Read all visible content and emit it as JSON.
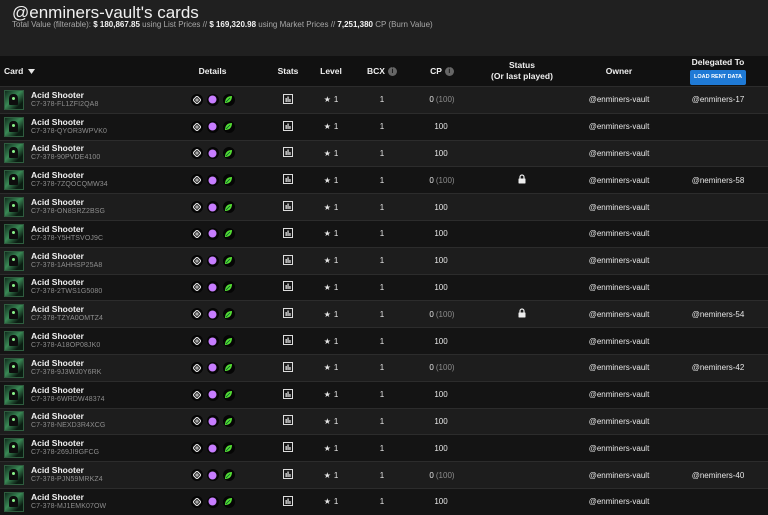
{
  "page": {
    "title": "@enminers-vault's cards",
    "summary": {
      "prefix": "Total Value (filterable): ",
      "list_value": "$ 180,867.85",
      "list_suffix": " using List Prices // ",
      "market_value": "$ 169,320.98",
      "market_suffix": " using Market Prices // ",
      "cp_value": "7,251,380",
      "cp_suffix": " CP (Burn Value)"
    }
  },
  "table": {
    "headers": {
      "card": "Card",
      "details": "Details",
      "stats": "Stats",
      "level": "Level",
      "bcx": "BCX",
      "cp": "CP",
      "status": "Status",
      "status_sub": "(Or last played)",
      "owner": "Owner",
      "delegated": "Delegated To",
      "load_rent": "LOAD RENT DATA"
    },
    "icons": {
      "sort": "caret-down-icon",
      "info": "info-circle-icon",
      "stats": "bar-chart-icon",
      "level": "star-icon",
      "lock": "lock-icon",
      "details": [
        "edition-icon",
        "rarity-purple-icon",
        "element-earth-icon"
      ]
    },
    "colors": {
      "purple": "#c77dff",
      "green": "#55dd33",
      "button": "#1f7ad6"
    },
    "rows": [
      {
        "name": "Acid Shooter",
        "id": "C7-378-FL1ZFI2QA8",
        "level": "1",
        "bcx": "1",
        "cp": "0",
        "cp_extra": "(100)",
        "locked": false,
        "owner": "@enminers-vault",
        "delegated": "@enminers-17"
      },
      {
        "name": "Acid Shooter",
        "id": "C7-378-QYOR3WPVK0",
        "level": "1",
        "bcx": "1",
        "cp": "100",
        "cp_extra": "",
        "locked": false,
        "owner": "@enminers-vault",
        "delegated": ""
      },
      {
        "name": "Acid Shooter",
        "id": "C7-378-90PVDE4100",
        "level": "1",
        "bcx": "1",
        "cp": "100",
        "cp_extra": "",
        "locked": false,
        "owner": "@enminers-vault",
        "delegated": ""
      },
      {
        "name": "Acid Shooter",
        "id": "C7-378-7ZQOCQMW34",
        "level": "1",
        "bcx": "1",
        "cp": "0",
        "cp_extra": "(100)",
        "locked": true,
        "owner": "@enminers-vault",
        "delegated": "@neminers-58"
      },
      {
        "name": "Acid Shooter",
        "id": "C7-378-ON8SRZ2BSG",
        "level": "1",
        "bcx": "1",
        "cp": "100",
        "cp_extra": "",
        "locked": false,
        "owner": "@enminers-vault",
        "delegated": ""
      },
      {
        "name": "Acid Shooter",
        "id": "C7-378-Y5HTSVOJ9C",
        "level": "1",
        "bcx": "1",
        "cp": "100",
        "cp_extra": "",
        "locked": false,
        "owner": "@enminers-vault",
        "delegated": ""
      },
      {
        "name": "Acid Shooter",
        "id": "C7-378-1AHHSP25A8",
        "level": "1",
        "bcx": "1",
        "cp": "100",
        "cp_extra": "",
        "locked": false,
        "owner": "@enminers-vault",
        "delegated": ""
      },
      {
        "name": "Acid Shooter",
        "id": "C7-378-2TWS1G5080",
        "level": "1",
        "bcx": "1",
        "cp": "100",
        "cp_extra": "",
        "locked": false,
        "owner": "@enminers-vault",
        "delegated": ""
      },
      {
        "name": "Acid Shooter",
        "id": "C7-378-TZYA0OMTZ4",
        "level": "1",
        "bcx": "1",
        "cp": "0",
        "cp_extra": "(100)",
        "locked": true,
        "owner": "@enminers-vault",
        "delegated": "@neminers-54"
      },
      {
        "name": "Acid Shooter",
        "id": "C7-378-A18OP08JK0",
        "level": "1",
        "bcx": "1",
        "cp": "100",
        "cp_extra": "",
        "locked": false,
        "owner": "@enminers-vault",
        "delegated": ""
      },
      {
        "name": "Acid Shooter",
        "id": "C7-378-9J3WJ0Y6RK",
        "level": "1",
        "bcx": "1",
        "cp": "0",
        "cp_extra": "(100)",
        "locked": false,
        "owner": "@enminers-vault",
        "delegated": "@neminers-42"
      },
      {
        "name": "Acid Shooter",
        "id": "C7-378-6WRDW48374",
        "level": "1",
        "bcx": "1",
        "cp": "100",
        "cp_extra": "",
        "locked": false,
        "owner": "@enminers-vault",
        "delegated": ""
      },
      {
        "name": "Acid Shooter",
        "id": "C7-378-NEXD3R4XCG",
        "level": "1",
        "bcx": "1",
        "cp": "100",
        "cp_extra": "",
        "locked": false,
        "owner": "@enminers-vault",
        "delegated": ""
      },
      {
        "name": "Acid Shooter",
        "id": "C7-378-269JI9GFCG",
        "level": "1",
        "bcx": "1",
        "cp": "100",
        "cp_extra": "",
        "locked": false,
        "owner": "@enminers-vault",
        "delegated": ""
      },
      {
        "name": "Acid Shooter",
        "id": "C7-378-PJN59MRKZ4",
        "level": "1",
        "bcx": "1",
        "cp": "0",
        "cp_extra": "(100)",
        "locked": false,
        "owner": "@enminers-vault",
        "delegated": "@neminers-40"
      },
      {
        "name": "Acid Shooter",
        "id": "C7-378-MJ1EMK07OW",
        "level": "1",
        "bcx": "1",
        "cp": "100",
        "cp_extra": "",
        "locked": false,
        "owner": "@enminers-vault",
        "delegated": ""
      }
    ]
  }
}
